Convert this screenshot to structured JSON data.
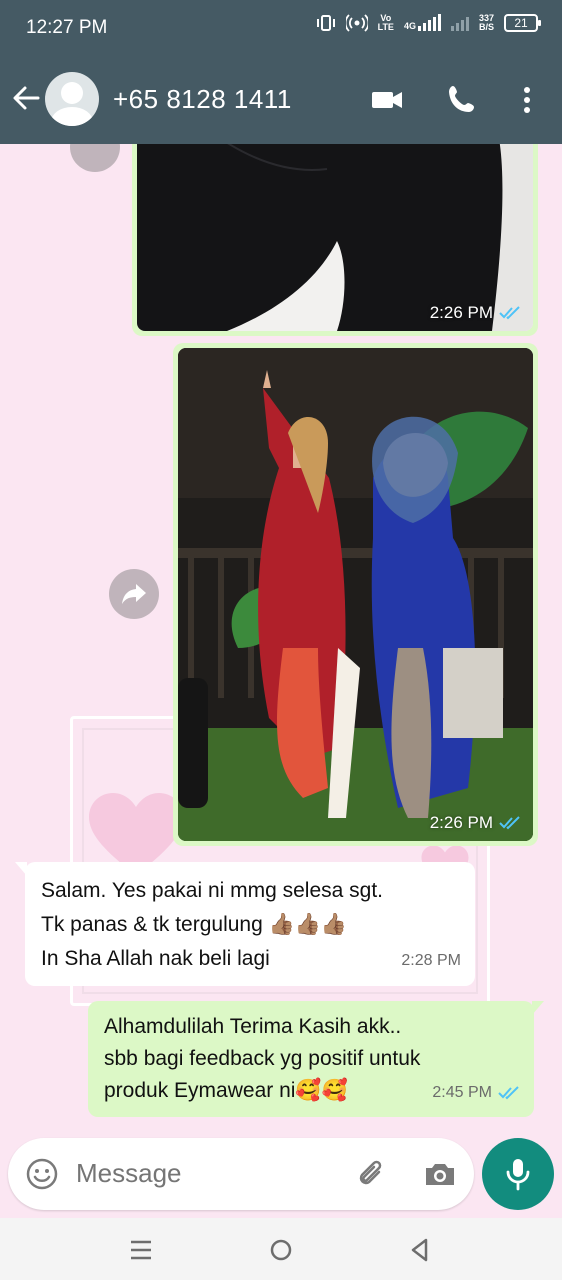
{
  "status_bar": {
    "time": "12:27 PM",
    "volte": "Vo\nLTE",
    "network": "4G",
    "speed_value": "337",
    "speed_unit": "B/S",
    "battery": "21"
  },
  "header": {
    "contact_name": "+65 8128 1411"
  },
  "messages": [
    {
      "type": "image",
      "direction": "outgoing",
      "time": "2:26 PM"
    },
    {
      "type": "image",
      "direction": "outgoing",
      "time": "2:26 PM"
    },
    {
      "type": "text",
      "direction": "incoming",
      "lines": [
        "Salam. Yes pakai ni mmg selesa sgt.",
        "Tk panas & tk tergulung 👍🏽👍🏽👍🏽",
        "In Sha Allah nak beli lagi"
      ],
      "time": "2:28 PM"
    },
    {
      "type": "text",
      "direction": "outgoing",
      "lines": [
        "Alhamdulilah Terima Kasih akk..",
        "sbb bagi feedback yg positif untuk",
        "produk Eymawear ni🥰🥰"
      ],
      "time": "2:45 PM"
    }
  ],
  "composer": {
    "placeholder": "Message"
  },
  "colors": {
    "header": "#455a64",
    "outgoing_bubble": "#dcf8c6",
    "chat_background": "#fbe6f2",
    "read_ticks": "#4fc3f7",
    "mic_button": "#128c7e"
  },
  "icons": {
    "back": "arrow-left-icon",
    "video": "video-call-icon",
    "call": "phone-icon",
    "menu": "more-vert-icon",
    "emoji": "emoji-icon",
    "attach": "paperclip-icon",
    "camera": "camera-icon",
    "mic": "mic-icon",
    "forward": "share-forward-icon"
  }
}
